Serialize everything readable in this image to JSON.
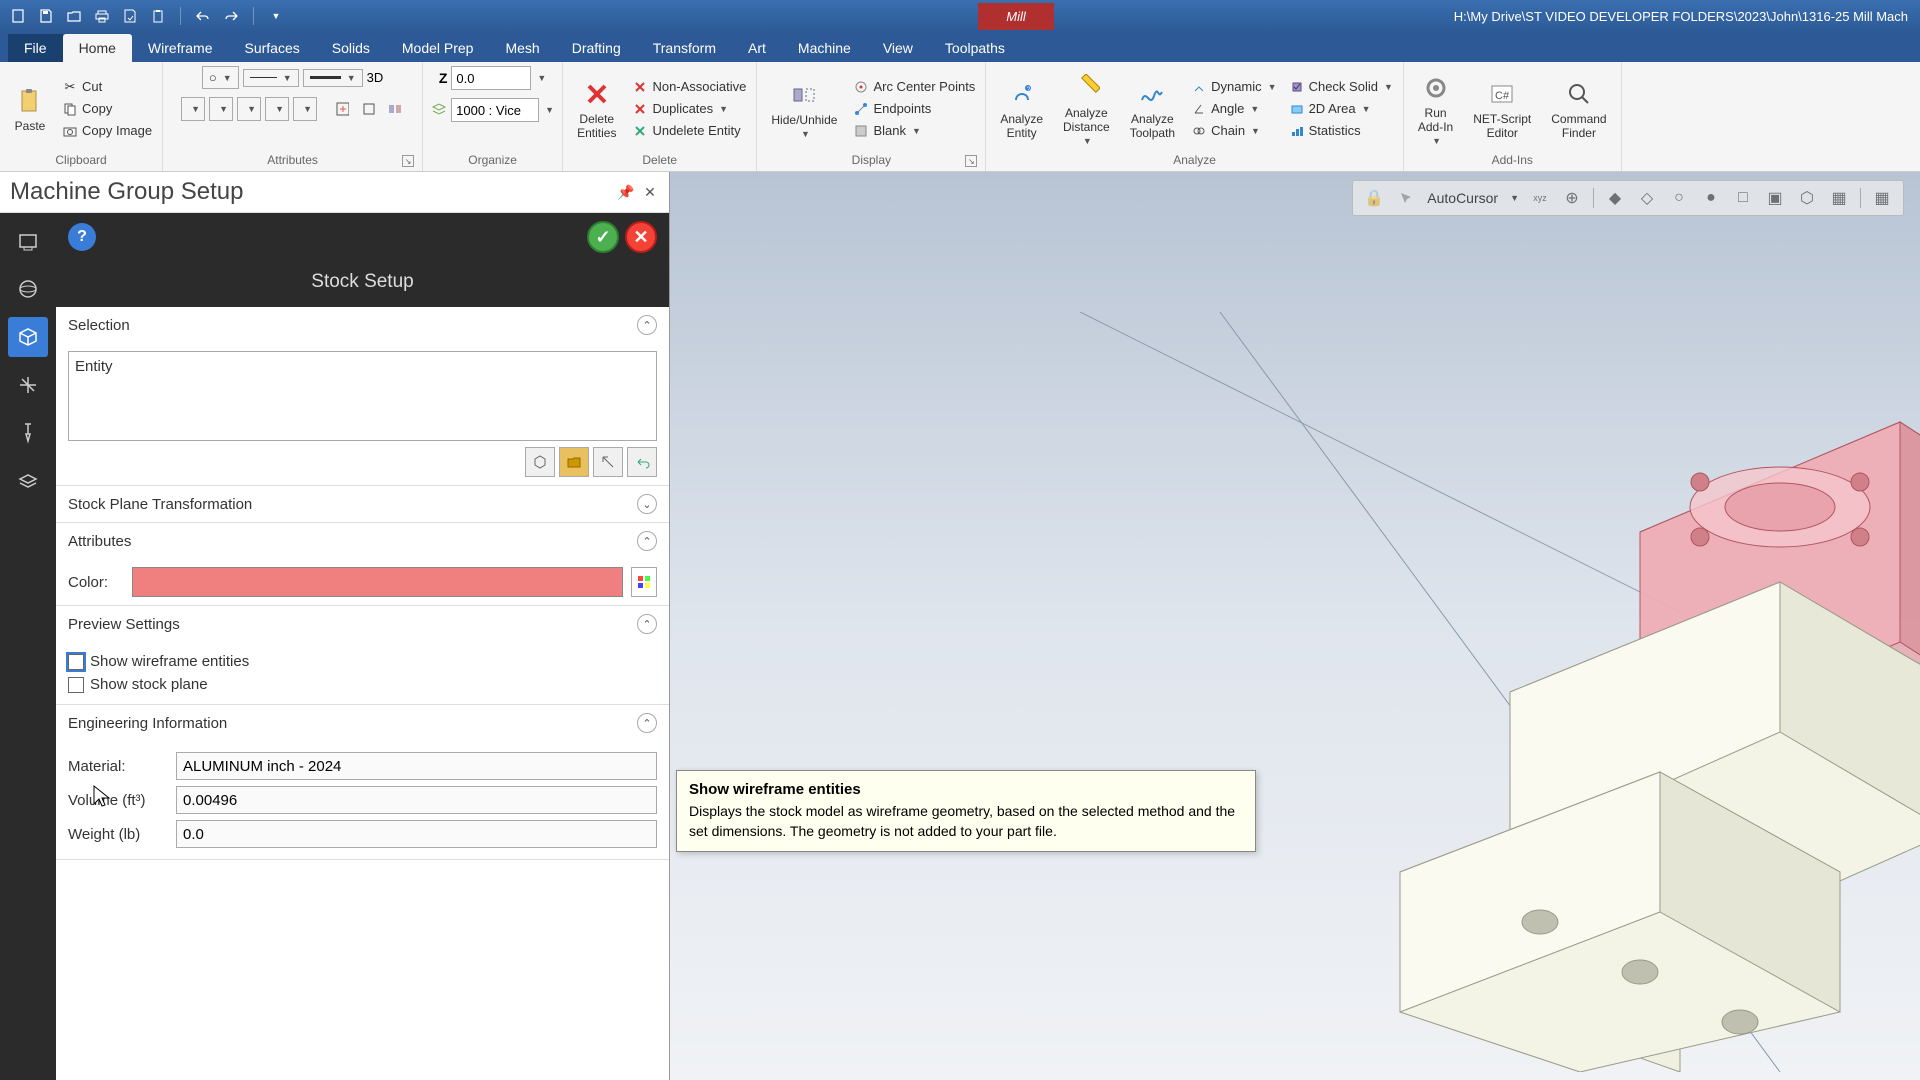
{
  "titlebar": {
    "path": "H:\\My Drive\\ST VIDEO DEVELOPER FOLDERS\\2023\\John\\1316-25 Mill Mach",
    "context_tab": "Mill"
  },
  "tabs": {
    "file": "File",
    "home": "Home",
    "wireframe": "Wireframe",
    "surfaces": "Surfaces",
    "solids": "Solids",
    "modelprep": "Model Prep",
    "mesh": "Mesh",
    "drafting": "Drafting",
    "transform": "Transform",
    "art": "Art",
    "machine": "Machine",
    "view": "View",
    "toolpaths": "Toolpaths"
  },
  "ribbon": {
    "clipboard": {
      "label": "Clipboard",
      "paste": "Paste",
      "cut": "Cut",
      "copy": "Copy",
      "copyimage": "Copy Image"
    },
    "attributes": {
      "label": "Attributes",
      "threeD": "3D"
    },
    "organize": {
      "label": "Organize",
      "z": "Z",
      "zval": "0.0",
      "level": "1000 : Vice"
    },
    "delete": {
      "label": "Delete",
      "delete_entities": "Delete\nEntities",
      "nonassoc": "Non-Associative",
      "duplicates": "Duplicates",
      "undelete": "Undelete Entity"
    },
    "display": {
      "label": "Display",
      "hide": "Hide/Unhide",
      "arc": "Arc Center Points",
      "endpoints": "Endpoints",
      "blank": "Blank"
    },
    "analyze": {
      "label": "Analyze",
      "entity": "Analyze\nEntity",
      "distance": "Analyze\nDistance",
      "toolpath": "Analyze\nToolpath",
      "dynamic": "Dynamic",
      "angle": "Angle",
      "chain": "Chain",
      "checksolid": "Check Solid",
      "twodarea": "2D Area",
      "statistics": "Statistics"
    },
    "addins": {
      "label": "Add-Ins",
      "run": "Run\nAdd-In",
      "netscript": "NET-Script\nEditor",
      "command": "Command\nFinder"
    }
  },
  "panel": {
    "title": "Machine Group Setup",
    "subtitle": "Stock Setup",
    "sections": {
      "selection": "Selection",
      "entity": "Entity",
      "stockplane": "Stock Plane Transformation",
      "attributes": "Attributes",
      "color": "Color:",
      "preview": "Preview Settings",
      "wireframe": "Show wireframe entities",
      "stockplane_chk": "Show stock plane",
      "engineering": "Engineering Information",
      "material_lbl": "Material:",
      "material_val": "ALUMINUM inch - 2024",
      "volume_lbl": "Volume (ft³)",
      "volume_val": "0.00496",
      "weight_lbl": "Weight (lb)",
      "weight_val": "0.0"
    }
  },
  "viewport": {
    "autocursor": "AutoCursor"
  },
  "tooltip": {
    "title": "Show wireframe entities",
    "body": "Displays the stock model as wireframe geometry, based on the selected method and the set dimensions. The geometry is not added to your part file."
  }
}
